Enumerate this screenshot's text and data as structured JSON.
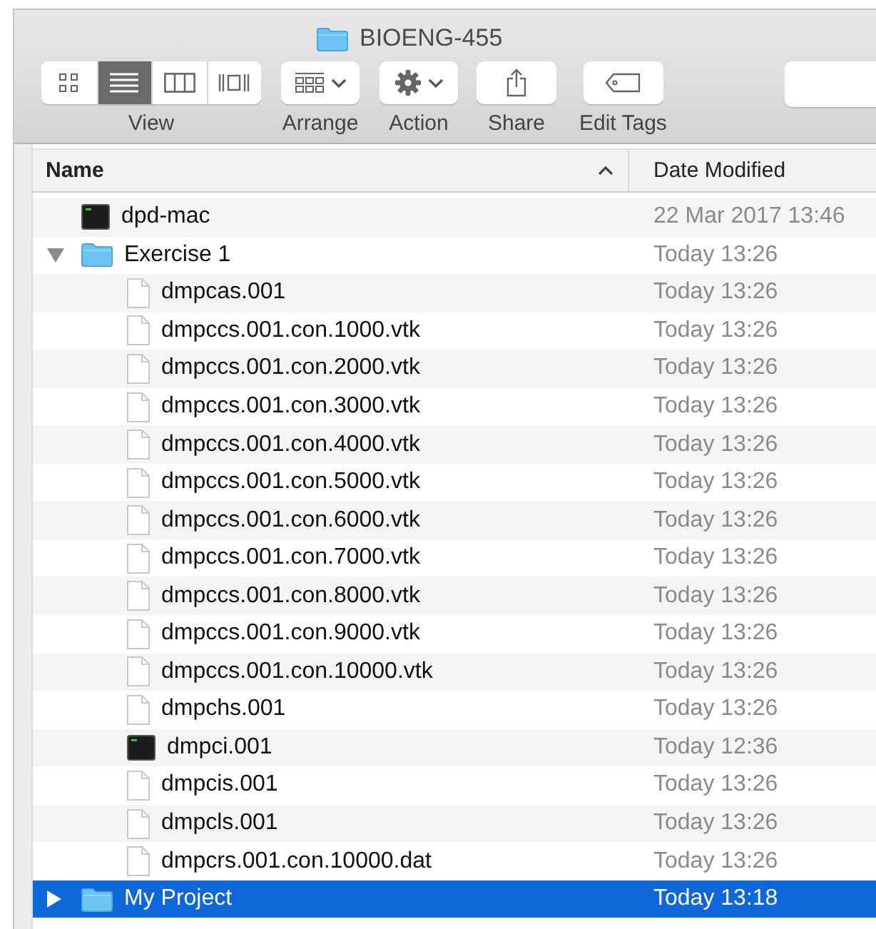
{
  "window": {
    "title": "BIOENG-455"
  },
  "toolbar": {
    "view_modes": [
      {
        "kind": "icons",
        "selected": false
      },
      {
        "kind": "list",
        "selected": true
      },
      {
        "kind": "columns",
        "selected": false
      },
      {
        "kind": "coverflow",
        "selected": false
      }
    ],
    "view_label": "View",
    "tools": [
      {
        "kind": "arrange",
        "label": "Arrange",
        "menu": true
      },
      {
        "kind": "action",
        "label": "Action",
        "menu": true
      },
      {
        "kind": "share",
        "label": "Share",
        "menu": false
      },
      {
        "kind": "tags",
        "label": "Edit Tags",
        "menu": false
      }
    ]
  },
  "columns": [
    {
      "label": "Name",
      "sorted": true
    },
    {
      "label": "Date Modified",
      "sorted": false
    }
  ],
  "rows": [
    {
      "name": "dpd-mac",
      "kind": "terminal",
      "date": "22 Mar 2017 13:46",
      "selected": false
    },
    {
      "name": "Exercise 1",
      "kind": "folder",
      "date": "Today 13:26",
      "selected": false,
      "expanded": true,
      "children": [
        {
          "name": "dmpcas.001",
          "kind": "document",
          "date": "Today 13:26",
          "selected": false
        },
        {
          "name": "dmpccs.001.con.1000.vtk",
          "kind": "document",
          "date": "Today 13:26",
          "selected": false
        },
        {
          "name": "dmpccs.001.con.2000.vtk",
          "kind": "document",
          "date": "Today 13:26",
          "selected": false
        },
        {
          "name": "dmpccs.001.con.3000.vtk",
          "kind": "document",
          "date": "Today 13:26",
          "selected": false
        },
        {
          "name": "dmpccs.001.con.4000.vtk",
          "kind": "document",
          "date": "Today 13:26",
          "selected": false
        },
        {
          "name": "dmpccs.001.con.5000.vtk",
          "kind": "document",
          "date": "Today 13:26",
          "selected": false
        },
        {
          "name": "dmpccs.001.con.6000.vtk",
          "kind": "document",
          "date": "Today 13:26",
          "selected": false
        },
        {
          "name": "dmpccs.001.con.7000.vtk",
          "kind": "document",
          "date": "Today 13:26",
          "selected": false
        },
        {
          "name": "dmpccs.001.con.8000.vtk",
          "kind": "document",
          "date": "Today 13:26",
          "selected": false
        },
        {
          "name": "dmpccs.001.con.9000.vtk",
          "kind": "document",
          "date": "Today 13:26",
          "selected": false
        },
        {
          "name": "dmpccs.001.con.10000.vtk",
          "kind": "document",
          "date": "Today 13:26",
          "selected": false
        },
        {
          "name": "dmpchs.001",
          "kind": "document",
          "date": "Today 13:26",
          "selected": false
        },
        {
          "name": "dmpci.001",
          "kind": "terminal",
          "date": "Today 12:36",
          "selected": false
        },
        {
          "name": "dmpcis.001",
          "kind": "document",
          "date": "Today 13:26",
          "selected": false
        },
        {
          "name": "dmpcls.001",
          "kind": "document",
          "date": "Today 13:26",
          "selected": false
        },
        {
          "name": "dmpcrs.001.con.10000.dat",
          "kind": "document",
          "date": "Today 13:26",
          "selected": false
        }
      ]
    },
    {
      "name": "My Project",
      "kind": "folder",
      "date": "Today 13:18",
      "selected": true,
      "expanded": false
    }
  ]
}
